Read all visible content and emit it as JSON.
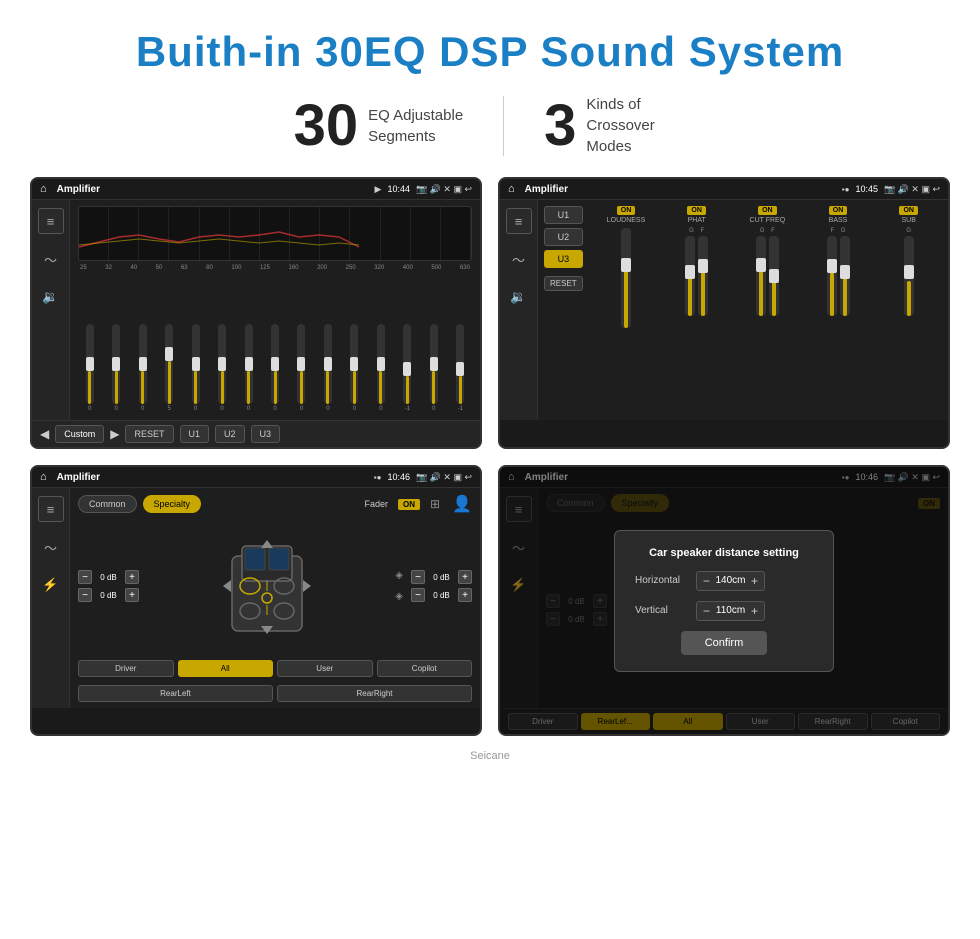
{
  "page": {
    "title": "Buith-in 30EQ DSP Sound System",
    "stat1_number": "30",
    "stat1_label": "EQ Adjustable\nSegments",
    "stat2_number": "3",
    "stat2_label": "Kinds of\nCrossover Modes"
  },
  "screen1": {
    "title": "Amplifier",
    "time": "10:44",
    "eq_labels": [
      "25",
      "32",
      "40",
      "50",
      "63",
      "80",
      "100",
      "125",
      "160",
      "200",
      "250",
      "320",
      "400",
      "500",
      "630"
    ],
    "eq_values": [
      "0",
      "0",
      "0",
      "5",
      "0",
      "0",
      "0",
      "0",
      "0",
      "0",
      "0",
      "0",
      "-1",
      "0",
      "-1"
    ],
    "bottom_buttons": [
      "Custom",
      "RESET",
      "U1",
      "U2",
      "U3"
    ]
  },
  "screen2": {
    "title": "Amplifier",
    "time": "10:45",
    "u_buttons": [
      "U1",
      "U2",
      "U3"
    ],
    "selected_u": "U3",
    "channels": [
      {
        "name": "LOUDNESS",
        "on": true
      },
      {
        "name": "PHAT",
        "on": true
      },
      {
        "name": "CUT FREQ",
        "on": true
      },
      {
        "name": "BASS",
        "on": true
      },
      {
        "name": "SUB",
        "on": true
      }
    ],
    "reset_label": "RESET"
  },
  "screen3": {
    "title": "Amplifier",
    "time": "10:46",
    "mode_buttons": [
      "Common",
      "Specialty"
    ],
    "active_mode": "Specialty",
    "fader_label": "Fader",
    "on_label": "ON",
    "volume_rows": [
      {
        "label": "0 dB"
      },
      {
        "label": "0 dB"
      },
      {
        "label": "0 dB"
      },
      {
        "label": "0 dB"
      }
    ],
    "bottom_buttons": [
      "Driver",
      "RearLeft",
      "All",
      "User",
      "RearRight",
      "Copilot"
    ]
  },
  "screen4": {
    "title": "Amplifier",
    "time": "10:46",
    "mode_buttons": [
      "Common",
      "Specialty"
    ],
    "active_mode": "Specialty",
    "on_label": "ON",
    "dialog": {
      "title": "Car speaker distance setting",
      "horizontal_label": "Horizontal",
      "horizontal_value": "140cm",
      "vertical_label": "Vertical",
      "vertical_value": "110cm",
      "confirm_label": "Confirm"
    },
    "volume_rows": [
      {
        "label": "0 dB"
      },
      {
        "label": "0 dB"
      }
    ],
    "bottom_buttons": [
      "Driver",
      "RearLef...",
      "All",
      "User",
      "RearRight",
      "Copilot"
    ]
  },
  "watermark": "Seicane"
}
